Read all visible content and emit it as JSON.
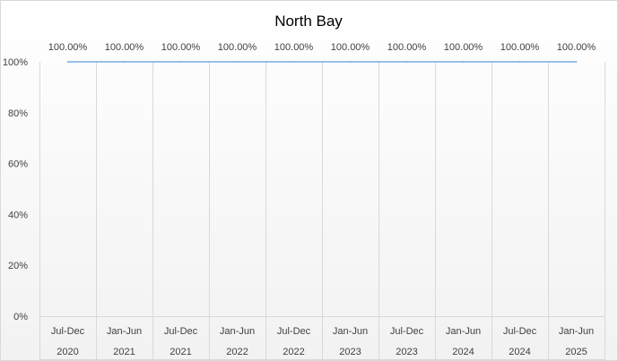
{
  "chart_data": {
    "type": "line",
    "title": "North Bay",
    "categories": [
      [
        "Jul-Dec",
        "2020"
      ],
      [
        "Jan-Jun",
        "2021"
      ],
      [
        "Jul-Dec",
        "2021"
      ],
      [
        "Jan-Jun",
        "2022"
      ],
      [
        "Jul-Dec",
        "2022"
      ],
      [
        "Jan-Jun",
        "2023"
      ],
      [
        "Jul-Dec",
        "2023"
      ],
      [
        "Jan-Jun",
        "2024"
      ],
      [
        "Jul-Dec",
        "2024"
      ],
      [
        "Jan-Jun",
        "2025"
      ]
    ],
    "series": [
      {
        "values": [
          1.0,
          1.0,
          1.0,
          1.0,
          1.0,
          1.0,
          1.0,
          1.0,
          1.0,
          1.0
        ],
        "data_labels": [
          "100.00%",
          "100.00%",
          "100.00%",
          "100.00%",
          "100.00%",
          "100.00%",
          "100.00%",
          "100.00%",
          "100.00%",
          "100.00%"
        ]
      }
    ],
    "y_ticks": [
      "0%",
      "20%",
      "40%",
      "60%",
      "80%",
      "100%"
    ],
    "ylim": [
      0,
      1
    ],
    "grid": "vertical",
    "legend": "none",
    "colors": {
      "line": "#5B9BD5",
      "grid": "#D9D9D9",
      "text": "#404040",
      "title": "#000000",
      "gradient_top": "#FFFFFF",
      "gradient_bottom": "#F2F2F2"
    }
  }
}
